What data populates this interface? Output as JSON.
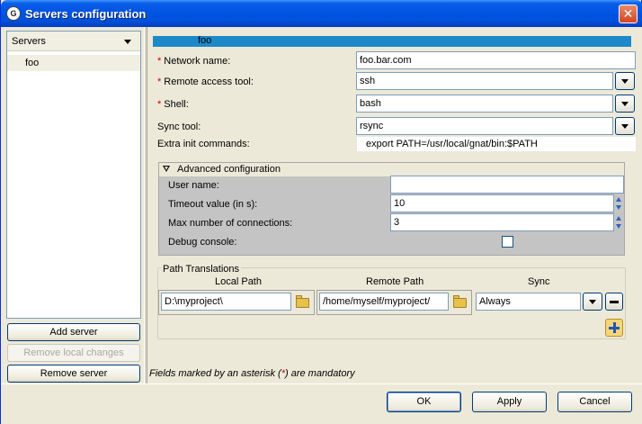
{
  "window": {
    "title": "Servers configuration",
    "app_icon": "gps-icon",
    "close_label": "✕"
  },
  "left": {
    "header_label": "Servers",
    "servers": [
      "foo"
    ],
    "add_server": "Add server",
    "remove_local_changes": "Remove local changes",
    "remove_server": "Remove server"
  },
  "form": {
    "selected_server": "foo",
    "network_name": {
      "label": "Network name:",
      "value": "foo.bar.com"
    },
    "remote_access_tool": {
      "label": "Remote access tool:",
      "value": "ssh"
    },
    "shell": {
      "label": "Shell:",
      "value": "bash"
    },
    "sync_tool": {
      "label": "Sync tool:",
      "value": "rsync"
    },
    "extra_init": {
      "label": "Extra init commands:",
      "value": "export PATH=/usr/local/gnat/bin:$PATH"
    },
    "required_marker": "*"
  },
  "advanced": {
    "title": "Advanced configuration",
    "user_name": {
      "label": "User name:",
      "value": ""
    },
    "timeout": {
      "label": "Timeout value (in s):",
      "value": "10"
    },
    "max_connections": {
      "label": "Max number of connections:",
      "value": "3"
    },
    "debug_console": {
      "label": "Debug console:",
      "checked": false
    }
  },
  "path_translations": {
    "title": "Path Translations",
    "columns": [
      "Local Path",
      "Remote Path",
      "Sync"
    ],
    "rows": [
      {
        "local": "D:\\myproject\\",
        "remote": "/home/myself/myproject/",
        "sync": "Always"
      }
    ]
  },
  "footer_note": {
    "prefix": "Fields marked by an asterisk (",
    "star": "*",
    "suffix": ") are mandatory"
  },
  "buttons": {
    "ok": "OK",
    "apply": "Apply",
    "cancel": "Cancel"
  },
  "colors": {
    "title_bar": "#0054e3",
    "selection": "#1d89c9",
    "required": "#d10000",
    "advanced_bg": "#c4c4c4"
  }
}
